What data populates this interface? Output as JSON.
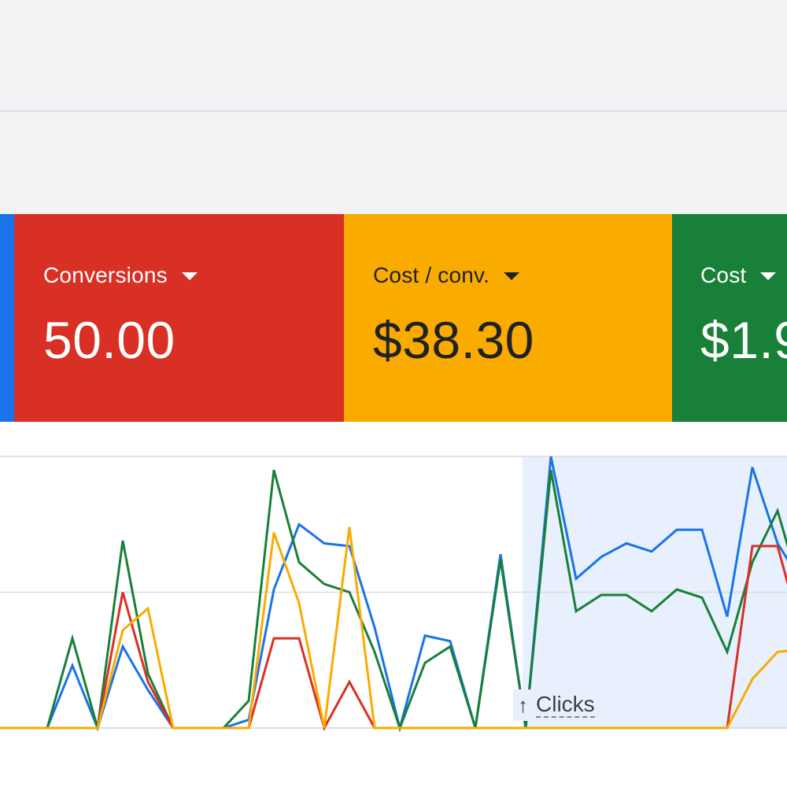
{
  "colors": {
    "blue": "#1a73e8",
    "red": "#d93025",
    "amber": "#f9ab00",
    "green": "#188038",
    "highlight": "#e8f0fe",
    "gridline": "#dadce0"
  },
  "scorecards": [
    {
      "label": "",
      "value": "",
      "color": "#1a73e8",
      "text_color": "#ffffff"
    },
    {
      "label": "Conversions",
      "value": "50.00",
      "color": "#d93025",
      "text_color": "#ffffff"
    },
    {
      "label": "Cost / conv.",
      "value": "$38.30",
      "color": "#f9ab00",
      "text_color": "#202124"
    },
    {
      "label": "Cost",
      "value": "$1.9",
      "color": "#188038",
      "text_color": "#ffffff"
    }
  ],
  "chart": {
    "axis_label": "Clicks",
    "axis_arrow": "↑"
  },
  "chart_data": {
    "type": "line",
    "x": [
      1,
      2,
      3,
      4,
      5,
      6,
      7,
      8,
      9,
      10,
      11,
      12,
      13,
      14,
      15,
      16,
      17,
      18,
      19,
      20,
      21,
      22,
      23,
      24,
      25,
      26,
      27,
      28,
      29,
      30,
      31,
      32,
      33
    ],
    "highlight_range": [
      22,
      33
    ],
    "ylim": [
      0,
      100
    ],
    "grid": true,
    "series": [
      {
        "color": "#1a73e8",
        "values": [
          0,
          0,
          0,
          23,
          0,
          30,
          14,
          0,
          0,
          0,
          3,
          51,
          75,
          68,
          67,
          37,
          0,
          34,
          32,
          0,
          64,
          0,
          100,
          55,
          63,
          68,
          65,
          73,
          73,
          41,
          96,
          68,
          53
        ]
      },
      {
        "color": "#188038",
        "values": [
          0,
          0,
          0,
          33,
          0,
          69,
          20,
          0,
          0,
          0,
          10,
          95,
          61,
          53,
          50,
          28,
          0,
          24,
          30,
          0,
          62,
          0,
          95,
          43,
          49,
          49,
          43,
          51,
          48,
          28,
          61,
          80,
          48
        ]
      },
      {
        "color": "#d93025",
        "values": [
          0,
          0,
          0,
          0,
          0,
          50,
          17,
          0,
          0,
          0,
          0,
          33,
          33,
          0,
          17,
          0,
          0,
          0,
          0,
          0,
          0,
          0,
          0,
          0,
          0,
          0,
          0,
          0,
          0,
          0,
          67,
          67,
          33
        ]
      },
      {
        "color": "#f9ab00",
        "values": [
          0,
          0,
          0,
          0,
          0,
          36,
          44,
          0,
          0,
          0,
          0,
          72,
          46,
          0,
          74,
          0,
          0,
          0,
          0,
          0,
          0,
          0,
          0,
          0,
          0,
          0,
          0,
          0,
          0,
          0,
          18,
          28,
          29
        ]
      }
    ]
  }
}
